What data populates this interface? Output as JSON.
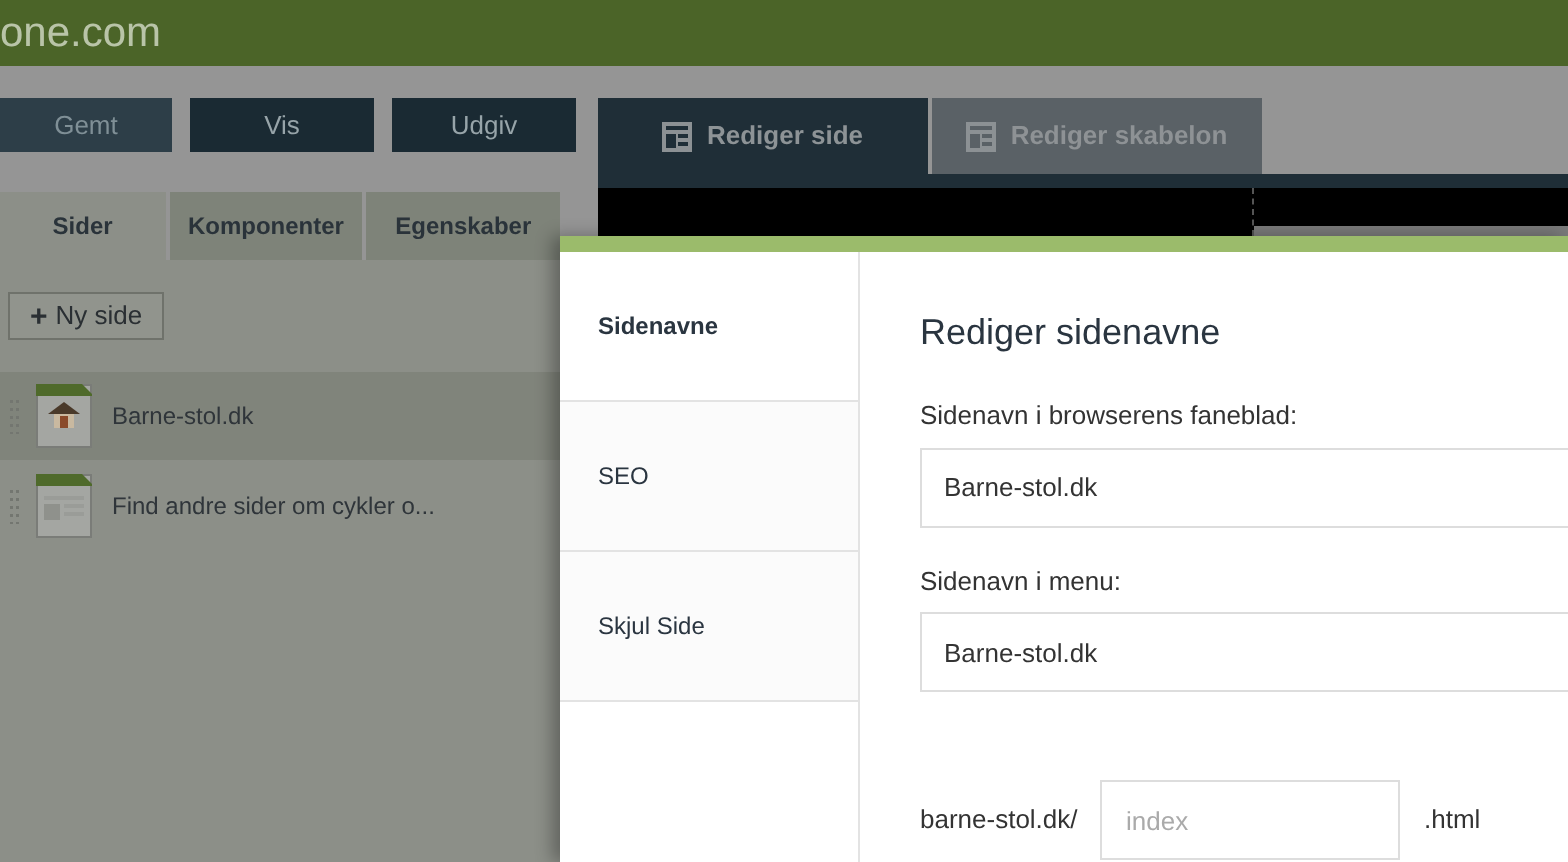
{
  "header": {
    "logo": "one.com"
  },
  "toolbar": {
    "buttons": [
      {
        "label": "Gemt",
        "disabled": true
      },
      {
        "label": "Vis",
        "disabled": false
      },
      {
        "label": "Udgiv",
        "disabled": false
      }
    ]
  },
  "edit_tabs": [
    {
      "label": "Rediger side",
      "selected": true
    },
    {
      "label": "Rediger skabelon",
      "selected": false
    }
  ],
  "panel_tabs": [
    {
      "label": "Sider",
      "selected": true
    },
    {
      "label": "Komponenter",
      "selected": false
    },
    {
      "label": "Egenskaber",
      "selected": false
    }
  ],
  "new_page_button": {
    "icon": "+",
    "label": "Ny side"
  },
  "pages": [
    {
      "title": "Barne-stol.dk",
      "kind": "home",
      "selected": true
    },
    {
      "title": "Find andre sider om cykler o...",
      "kind": "page",
      "selected": false
    }
  ],
  "dialog": {
    "menu": [
      {
        "label": "Sidenavne",
        "selected": true
      },
      {
        "label": "SEO",
        "selected": false
      },
      {
        "label": "Skjul Side",
        "selected": false
      }
    ],
    "title": "Rediger sidenavne",
    "fields": [
      {
        "label": "Sidenavn i browserens faneblad:",
        "value": "Barne-stol.dk"
      },
      {
        "label": "Sidenavn i menu:",
        "value": "Barne-stol.dk"
      }
    ],
    "url": {
      "prefix": "barne-stol.dk/",
      "placeholder": "index",
      "suffix": ".html"
    }
  }
}
